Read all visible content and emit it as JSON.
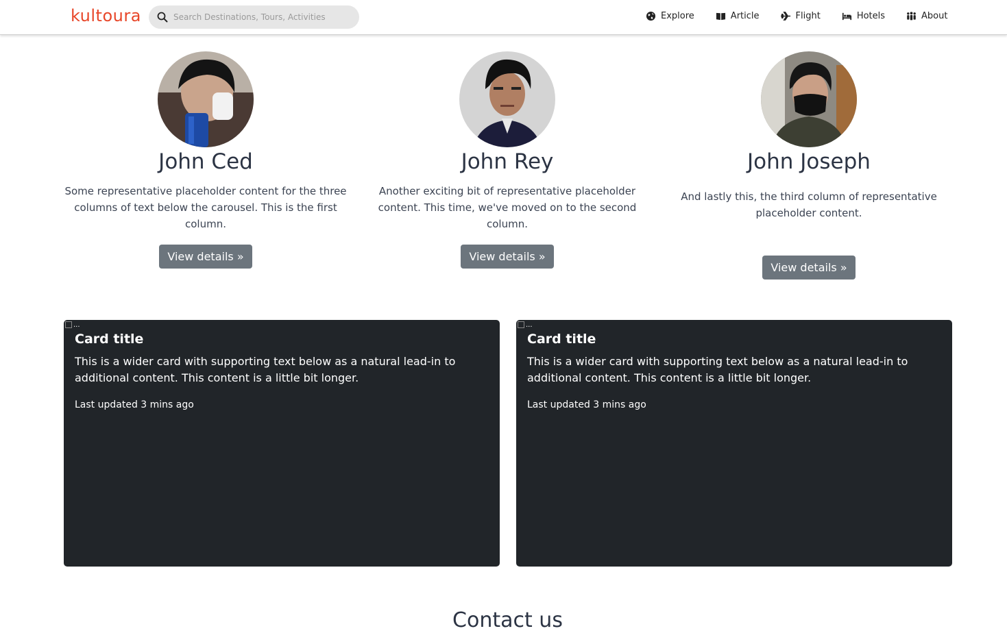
{
  "brand": "kultoura",
  "search": {
    "placeholder": "Search Destinations, Tours, Activities"
  },
  "nav": [
    {
      "label": "Explore",
      "icon": "globe-icon"
    },
    {
      "label": "Article",
      "icon": "book-icon"
    },
    {
      "label": "Flight",
      "icon": "plane-icon"
    },
    {
      "label": "Hotels",
      "icon": "bed-icon"
    },
    {
      "label": "About",
      "icon": "people-icon"
    }
  ],
  "team": [
    {
      "name": "John Ced",
      "text": "Some representative placeholder content for the three columns of text below the carousel. This is the first column.",
      "button": "View details »"
    },
    {
      "name": "John Rey",
      "text": "Another exciting bit of representative placeholder content. This time, we've moved on to the second column.",
      "button": "View details »"
    },
    {
      "name": "John Joseph",
      "text": "And lastly this, the third column of representative placeholder content.",
      "button": "View details »"
    }
  ],
  "cards": [
    {
      "img_alt": "...",
      "title": "Card title",
      "text": "This is a wider card with supporting text below as a natural lead-in to additional content. This content is a little bit longer.",
      "meta": "Last updated 3 mins ago"
    },
    {
      "img_alt": "...",
      "title": "Card title",
      "text": "This is a wider card with supporting text below as a natural lead-in to additional content. This content is a little bit longer.",
      "meta": "Last updated 3 mins ago"
    }
  ],
  "contact_title": "Contact us",
  "colors": {
    "brand": "#e8472a",
    "card_bg": "#212529",
    "button_bg": "#6c757d"
  }
}
